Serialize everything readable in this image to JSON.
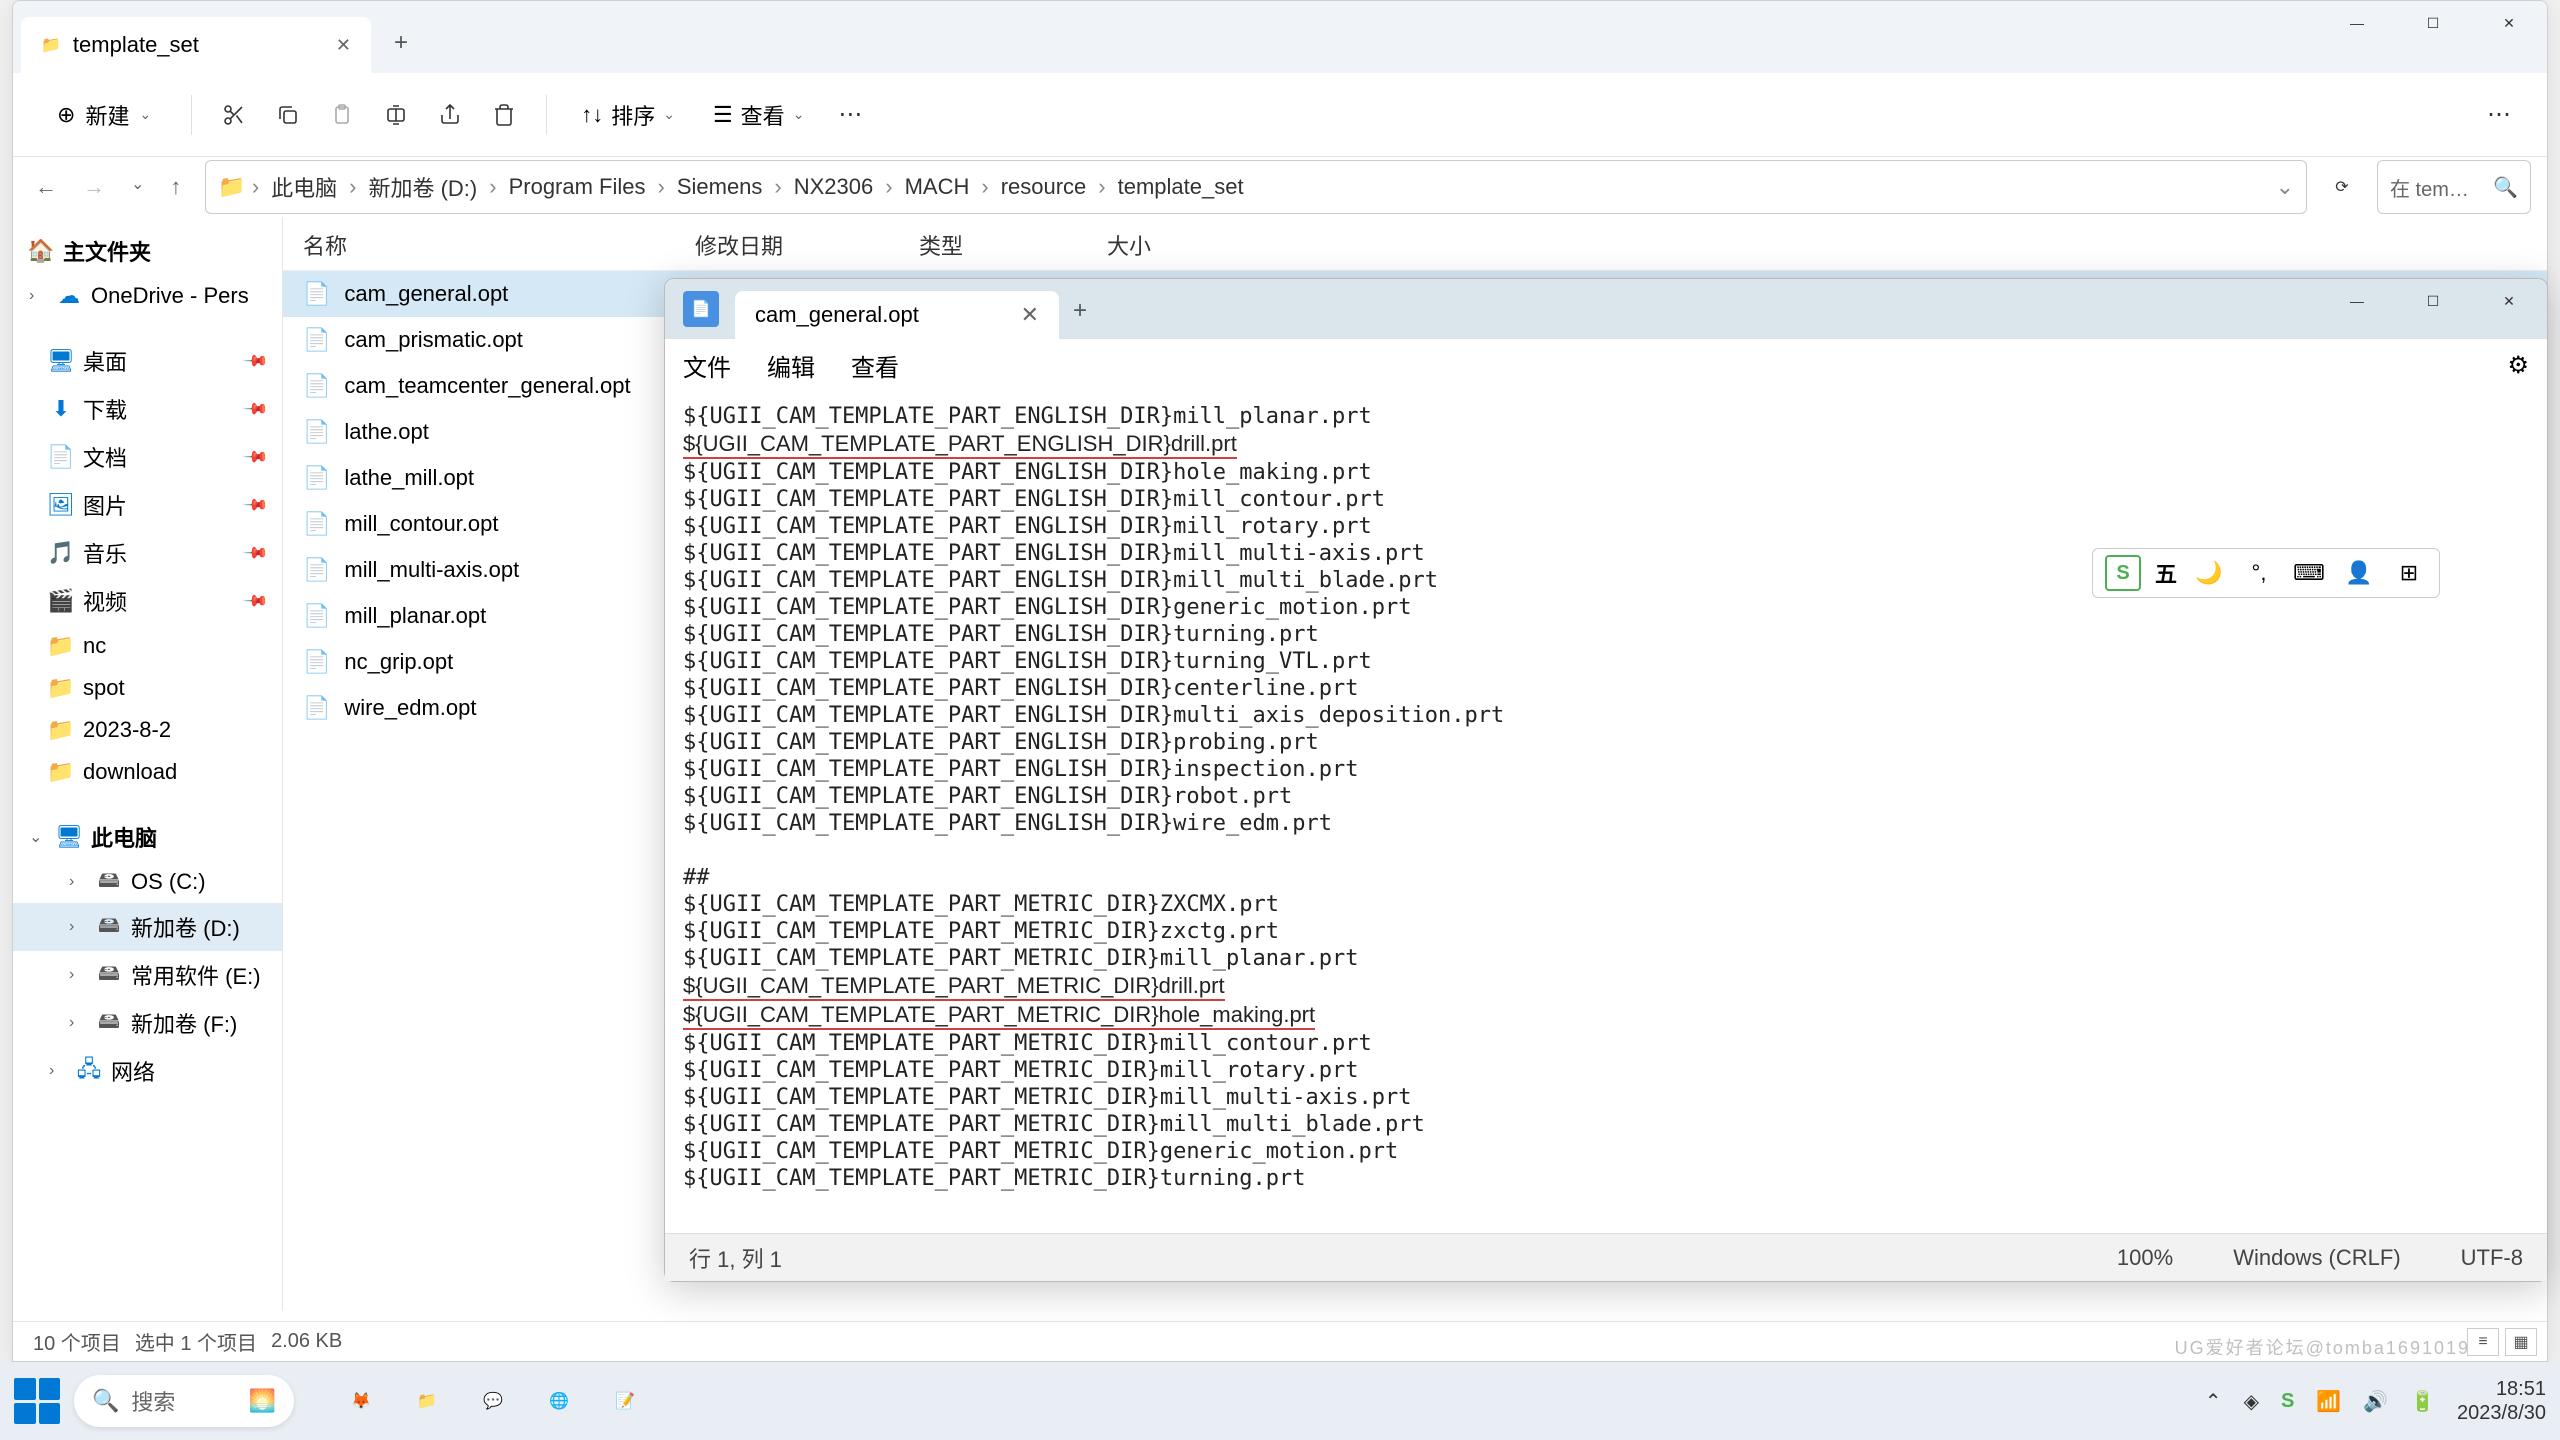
{
  "explorer": {
    "tab_title": "template_set",
    "toolbar": {
      "new_label": "新建",
      "sort_label": "排序",
      "view_label": "查看"
    },
    "breadcrumb": [
      "此电脑",
      "新加卷 (D:)",
      "Program Files",
      "Siemens",
      "NX2306",
      "MACH",
      "resource",
      "template_set"
    ],
    "search_placeholder": "在 tem…",
    "sidebar": {
      "home": "主文件夹",
      "onedrive": "OneDrive - Pers",
      "quick": [
        {
          "icon": "desktop",
          "label": "桌面"
        },
        {
          "icon": "download",
          "label": "下载"
        },
        {
          "icon": "docs",
          "label": "文档"
        },
        {
          "icon": "pics",
          "label": "图片"
        },
        {
          "icon": "music",
          "label": "音乐"
        },
        {
          "icon": "video",
          "label": "视频"
        },
        {
          "icon": "folder",
          "label": "nc"
        },
        {
          "icon": "folder",
          "label": "spot"
        },
        {
          "icon": "folder",
          "label": "2023-8-2"
        },
        {
          "icon": "folder",
          "label": "download"
        }
      ],
      "this_pc": "此电脑",
      "drives": [
        {
          "label": "OS (C:)"
        },
        {
          "label": "新加卷 (D:)",
          "selected": true
        },
        {
          "label": "常用软件 (E:)"
        },
        {
          "label": "新加卷 (F:)"
        }
      ],
      "network": "网络"
    },
    "columns": {
      "name": "名称",
      "date": "修改日期",
      "type": "类型",
      "size": "大小"
    },
    "files": [
      {
        "name": "cam_general.opt",
        "selected": true
      },
      {
        "name": "cam_prismatic.opt"
      },
      {
        "name": "cam_teamcenter_general.opt"
      },
      {
        "name": "lathe.opt"
      },
      {
        "name": "lathe_mill.opt"
      },
      {
        "name": "mill_contour.opt"
      },
      {
        "name": "mill_multi-axis.opt"
      },
      {
        "name": "mill_planar.opt"
      },
      {
        "name": "nc_grip.opt"
      },
      {
        "name": "wire_edm.opt"
      }
    ],
    "status": {
      "items": "10 个项目",
      "selected": "选中 1 个项目",
      "size": "2.06 KB"
    }
  },
  "notepad": {
    "tab_title": "cam_general.opt",
    "menu": {
      "file": "文件",
      "edit": "编辑",
      "view": "查看"
    },
    "content_lines": [
      "${UGII_CAM_TEMPLATE_PART_ENGLISH_DIR}mill_planar.prt",
      "${UGII_CAM_TEMPLATE_PART_ENGLISH_DIR}drill.prt",
      "${UGII_CAM_TEMPLATE_PART_ENGLISH_DIR}hole_making.prt",
      "${UGII_CAM_TEMPLATE_PART_ENGLISH_DIR}mill_contour.prt",
      "${UGII_CAM_TEMPLATE_PART_ENGLISH_DIR}mill_rotary.prt",
      "${UGII_CAM_TEMPLATE_PART_ENGLISH_DIR}mill_multi-axis.prt",
      "${UGII_CAM_TEMPLATE_PART_ENGLISH_DIR}mill_multi_blade.prt",
      "${UGII_CAM_TEMPLATE_PART_ENGLISH_DIR}generic_motion.prt",
      "${UGII_CAM_TEMPLATE_PART_ENGLISH_DIR}turning.prt",
      "${UGII_CAM_TEMPLATE_PART_ENGLISH_DIR}turning_VTL.prt",
      "${UGII_CAM_TEMPLATE_PART_ENGLISH_DIR}centerline.prt",
      "${UGII_CAM_TEMPLATE_PART_ENGLISH_DIR}multi_axis_deposition.prt",
      "${UGII_CAM_TEMPLATE_PART_ENGLISH_DIR}probing.prt",
      "${UGII_CAM_TEMPLATE_PART_ENGLISH_DIR}inspection.prt",
      "${UGII_CAM_TEMPLATE_PART_ENGLISH_DIR}robot.prt",
      "${UGII_CAM_TEMPLATE_PART_ENGLISH_DIR}wire_edm.prt",
      "",
      "##",
      "${UGII_CAM_TEMPLATE_PART_METRIC_DIR}ZXCMX.prt",
      "${UGII_CAM_TEMPLATE_PART_METRIC_DIR}zxctg.prt",
      "${UGII_CAM_TEMPLATE_PART_METRIC_DIR}mill_planar.prt",
      "${UGII_CAM_TEMPLATE_PART_METRIC_DIR}drill.prt",
      "${UGII_CAM_TEMPLATE_PART_METRIC_DIR}hole_making.prt",
      "${UGII_CAM_TEMPLATE_PART_METRIC_DIR}mill_contour.prt",
      "${UGII_CAM_TEMPLATE_PART_METRIC_DIR}mill_rotary.prt",
      "${UGII_CAM_TEMPLATE_PART_METRIC_DIR}mill_multi-axis.prt",
      "${UGII_CAM_TEMPLATE_PART_METRIC_DIR}mill_multi_blade.prt",
      "${UGII_CAM_TEMPLATE_PART_METRIC_DIR}generic_motion.prt",
      "${UGII_CAM_TEMPLATE_PART_METRIC_DIR}turning.prt"
    ],
    "underlined_line_indices": [
      1,
      21,
      22
    ],
    "status": {
      "pos": "行 1, 列 1",
      "zoom": "100%",
      "eol": "Windows (CRLF)",
      "enc": "UTF-8"
    }
  },
  "ime": {
    "lang": "五"
  },
  "taskbar": {
    "search": "搜索",
    "time": "18:51",
    "date": "2023/8/30"
  },
  "watermark": "UG爱好者论坛@tomba1691019"
}
